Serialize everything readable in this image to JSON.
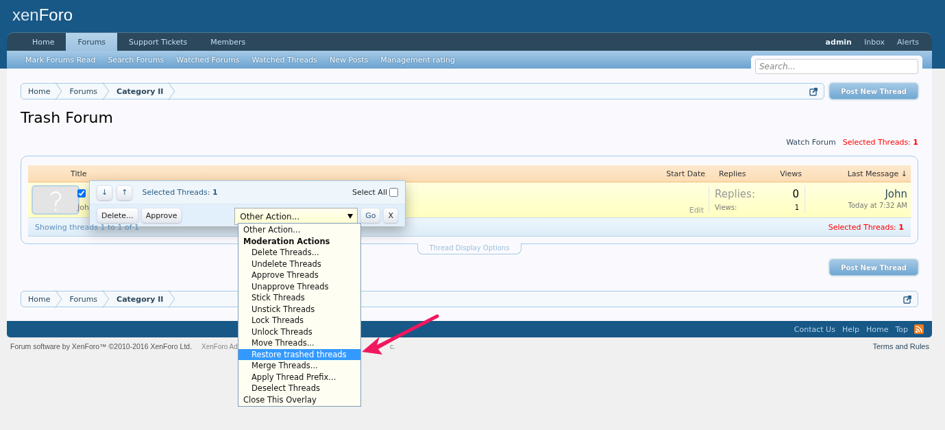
{
  "logo": {
    "light": "xen",
    "bold": "Foro"
  },
  "nav": {
    "tabs": [
      {
        "label": "Home",
        "selected": false
      },
      {
        "label": "Forums",
        "selected": true
      },
      {
        "label": "Support Tickets",
        "selected": false
      },
      {
        "label": "Members",
        "selected": false
      }
    ],
    "user_links": [
      "admin",
      "Inbox",
      "Alerts"
    ]
  },
  "subnav": [
    "Mark Forums Read",
    "Search Forums",
    "Watched Forums",
    "Watched Threads",
    "New Posts",
    "Management rating"
  ],
  "search": {
    "placeholder": "Search..."
  },
  "breadcrumbs": [
    "Home",
    "Forums",
    "Category II"
  ],
  "post_button": "Post New Thread",
  "title": "Trash Forum",
  "forum_links": {
    "watch": "Watch Forum",
    "selected_label": "Selected Threads:",
    "selected_count": "1"
  },
  "thread_list": {
    "columns": [
      "Title",
      "Start Date",
      "Replies",
      "Views",
      "Last Message ↓"
    ],
    "rows": [
      {
        "checked": true,
        "author": "Joh",
        "edit": "Edit",
        "replies_label": "Replies:",
        "replies": "0",
        "views_label": "Views:",
        "views": "1",
        "last_user": "John",
        "last_time": "Today at 7:32 AM"
      }
    ],
    "footer": "Showing threads 1 to 1 of 1",
    "selected_label": "Selected Threads:",
    "selected_count": "1"
  },
  "display_options": "Thread Display Options",
  "bottom_button": "Post New Thread",
  "bottom_breadcrumbs": [
    "Home",
    "Forums",
    "Category II"
  ],
  "footer_links": [
    "Contact Us",
    "Help",
    "Home",
    "Top"
  ],
  "copyright": "Forum software by XenForo™ ©2010-2016 XenForo Ltd.",
  "copyright_extra": [
    "XenForo Ad",
    "c."
  ],
  "terms": "Terms and Rules",
  "moderation": {
    "sort_buttons": [
      "↓",
      "↑"
    ],
    "selected_label": "Selected Threads:",
    "selected_count": "1",
    "select_all": "Select All",
    "select_all_checked": false,
    "buttons": [
      "Delete...",
      "Approve"
    ],
    "action": "Other Action...",
    "go": "Go",
    "close": "X",
    "menu": [
      {
        "kind": "option",
        "label": "Other Action...",
        "selected": false
      },
      {
        "kind": "group",
        "label": "Moderation Actions",
        "selected": false
      },
      {
        "kind": "suboption",
        "label": "Delete Threads...",
        "selected": false
      },
      {
        "kind": "suboption",
        "label": "Undelete Threads",
        "selected": false
      },
      {
        "kind": "suboption",
        "label": "Approve Threads",
        "selected": false
      },
      {
        "kind": "suboption",
        "label": "Unapprove Threads",
        "selected": false
      },
      {
        "kind": "suboption",
        "label": "Stick Threads",
        "selected": false
      },
      {
        "kind": "suboption",
        "label": "Unstick Threads",
        "selected": false
      },
      {
        "kind": "suboption",
        "label": "Lock Threads",
        "selected": false
      },
      {
        "kind": "suboption",
        "label": "Unlock Threads",
        "selected": false
      },
      {
        "kind": "suboption",
        "label": "Move Threads...",
        "selected": false
      },
      {
        "kind": "suboption",
        "label": "Restore trashed threads",
        "selected": true
      },
      {
        "kind": "suboption",
        "label": "Merge Threads...",
        "selected": false
      },
      {
        "kind": "suboption",
        "label": "Apply Thread Prefix...",
        "selected": false
      },
      {
        "kind": "suboption",
        "label": "Deselect Threads",
        "selected": false
      },
      {
        "kind": "option",
        "label": "Close This Overlay",
        "selected": false
      }
    ]
  }
}
